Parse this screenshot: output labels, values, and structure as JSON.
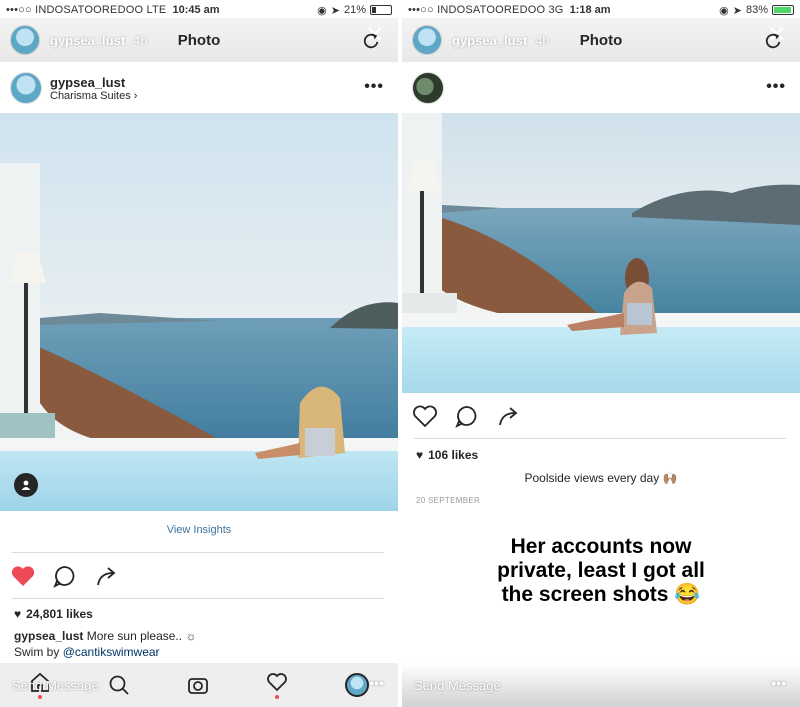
{
  "left": {
    "status": {
      "carrier": "•••○○ INDOSATOOREDOO  LTE",
      "time": "10:45 am",
      "battery": "21%",
      "battery_level": 0.21
    },
    "story": {
      "username": "gypsea_lust",
      "age": "4h",
      "title": "Photo"
    },
    "post": {
      "username": "gypsea_lust",
      "location": "Charisma Suites",
      "view_insights": "View Insights",
      "likes": "24,801 likes",
      "caption_user": "gypsea_lust",
      "caption_text": "More sun please.. ☼",
      "caption_line2_prefix": "Swim by ",
      "caption_mention": "@cantikswimwear"
    },
    "send_message": "Send Message"
  },
  "right": {
    "status": {
      "carrier": "•••○○ INDOSATOOREDOO  3G",
      "time": "1:18 am",
      "battery": "83%",
      "battery_level": 0.83
    },
    "story": {
      "username": "gypsea_lust",
      "age": "4h",
      "title": "Photo"
    },
    "post": {
      "likes": "106 likes",
      "caption": "Poolside views every day 🙌🏽",
      "date": "20 SEPTEMBER"
    },
    "overlay_text": [
      "Her accounts now",
      "private, least I got all",
      "the screen shots 😂"
    ],
    "send_message": "Send Message"
  },
  "colors": {
    "liked_heart": "#ed4956",
    "mention": "#003569",
    "insights_link": "#3f729b",
    "battery_charging": "#4cd964"
  },
  "icons": [
    "close-icon",
    "refresh-icon",
    "more-icon",
    "heart-icon",
    "comment-icon",
    "share-icon",
    "home-icon",
    "search-icon",
    "camera-icon",
    "activity-icon",
    "user-tag-icon"
  ]
}
